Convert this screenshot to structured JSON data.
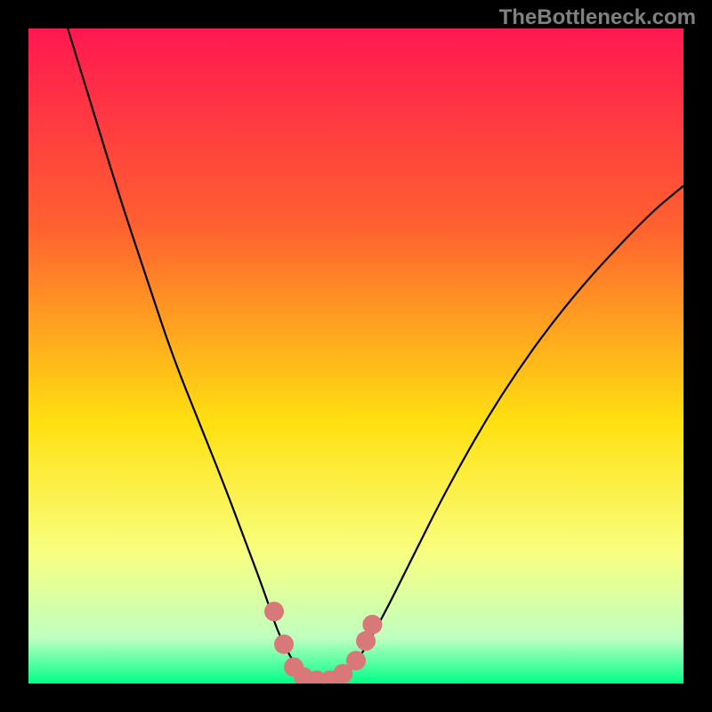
{
  "watermark": "TheBottleneck.com",
  "chart_data": {
    "type": "line",
    "title": "",
    "xlabel": "",
    "ylabel": "",
    "xlim": [
      0,
      100
    ],
    "ylim": [
      0,
      100
    ],
    "gradient_stops": [
      {
        "pos": 0,
        "color": "#ff1850"
      },
      {
        "pos": 30,
        "color": "#ff6030"
      },
      {
        "pos": 60,
        "color": "#ffe010"
      },
      {
        "pos": 80,
        "color": "#f8ff80"
      },
      {
        "pos": 93,
        "color": "#c0ffc0"
      },
      {
        "pos": 100,
        "color": "#00ff88"
      }
    ],
    "series": [
      {
        "name": "bottleneck-curve",
        "x": [
          6,
          10,
          14,
          18,
          22,
          26,
          30,
          33,
          36,
          38,
          40,
          42,
          44,
          46,
          48,
          50,
          54,
          58,
          64,
          72,
          82,
          94,
          100
        ],
        "y": [
          100,
          87,
          74,
          62,
          50,
          40,
          30,
          22,
          14,
          8,
          4,
          1,
          0.5,
          0.5,
          1,
          3,
          10,
          18,
          30,
          44,
          58,
          71,
          76
        ]
      }
    ],
    "markers": {
      "name": "optimal-zone",
      "color": "#d87878",
      "points": [
        {
          "x": 37.5,
          "y": 11
        },
        {
          "x": 39,
          "y": 6
        },
        {
          "x": 40.5,
          "y": 2.5
        },
        {
          "x": 42,
          "y": 1
        },
        {
          "x": 44,
          "y": 0.5
        },
        {
          "x": 46,
          "y": 0.5
        },
        {
          "x": 48,
          "y": 1.5
        },
        {
          "x": 50,
          "y": 3.5
        },
        {
          "x": 51.5,
          "y": 6.5
        },
        {
          "x": 52.5,
          "y": 9
        }
      ]
    }
  }
}
